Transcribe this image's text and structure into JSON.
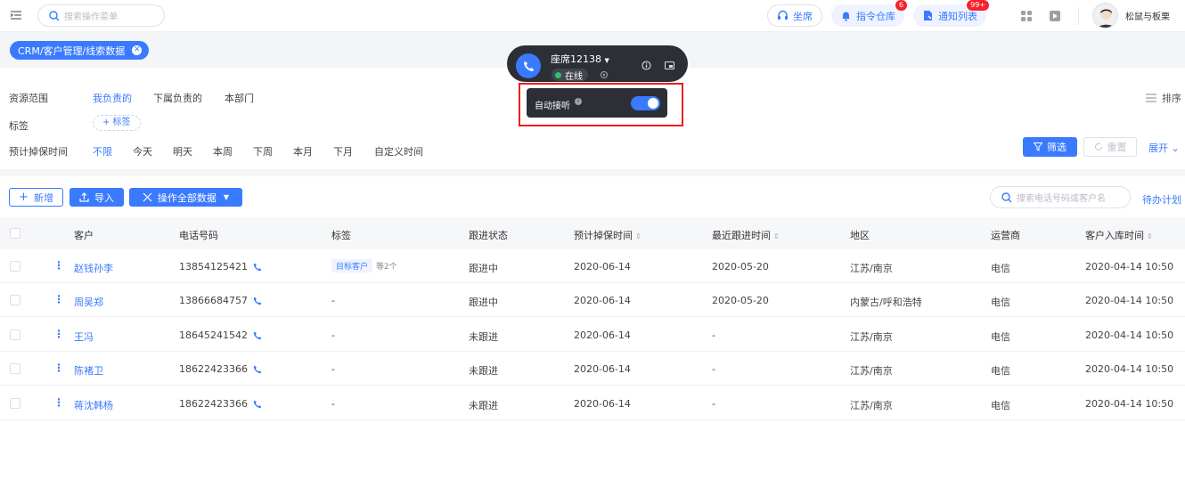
{
  "header": {
    "search_placeholder": "搜索操作菜单",
    "seat_label": "坐席",
    "command_label": "指令仓库",
    "command_badge": "6",
    "notify_label": "通知列表",
    "notify_badge": "99+",
    "user_name": "松鼠与板栗"
  },
  "tabs": {
    "crumb": "CRM/客户管理/线索数据"
  },
  "filters": {
    "scope_label": "资源范围",
    "scope_options": [
      "我负责的",
      "下属负责的",
      "本部门"
    ],
    "tag_label": "标签",
    "tag_add": "+ 标签",
    "time_label": "预计掉保时间",
    "time_options": [
      "不限",
      "今天",
      "明天",
      "本周",
      "下周",
      "本月",
      "下月",
      "自定义时间"
    ],
    "sort_label": "排序",
    "filter_button": "筛选",
    "reset_button": "重置",
    "expand_label": "展开"
  },
  "toolbar": {
    "add_label": "新增",
    "import_label": "导入",
    "bulk_label": "操作全部数据",
    "search_placeholder": "搜索电话号码或客户名",
    "todo_label": "待办计划"
  },
  "table": {
    "columns": [
      "客户",
      "电话号码",
      "标签",
      "跟进状态",
      "预计掉保时间",
      "最近跟进时间",
      "地区",
      "运营商",
      "客户入库时间"
    ],
    "rows": [
      {
        "customer": "赵钱孙李",
        "phone": "13854125421",
        "tag": "目标客户",
        "tag_more": "等2个",
        "status": "跟进中",
        "expire": "2020-06-14",
        "last": "2020-05-20",
        "region": "江苏/南京",
        "carrier": "电信",
        "stored": "2020-04-14  10:50"
      },
      {
        "customer": "周吴郑",
        "phone": "13866684757",
        "tag": "-",
        "tag_more": "",
        "status": "跟进中",
        "expire": "2020-06-14",
        "last": "2020-05-20",
        "region": "内蒙古/呼和浩特",
        "carrier": "电信",
        "stored": "2020-04-14  10:50"
      },
      {
        "customer": "王冯",
        "phone": "18645241542",
        "tag": "-",
        "tag_more": "",
        "status": "未跟进",
        "expire": "2020-06-14",
        "last": "-",
        "region": "江苏/南京",
        "carrier": "电信",
        "stored": "2020-04-14  10:50"
      },
      {
        "customer": "陈褚卫",
        "phone": "18622423366",
        "tag": "-",
        "tag_more": "",
        "status": "未跟进",
        "expire": "2020-06-14",
        "last": "-",
        "region": "江苏/南京",
        "carrier": "电信",
        "stored": "2020-04-14  10:50"
      },
      {
        "customer": "蒋沈韩杨",
        "phone": "18622423366",
        "tag": "-",
        "tag_more": "",
        "status": "未跟进",
        "expire": "2020-06-14",
        "last": "-",
        "region": "江苏/南京",
        "carrier": "电信",
        "stored": "2020-04-14  10:50"
      }
    ]
  },
  "cti": {
    "seat": "座席12138",
    "status": "在线",
    "auto_answer_label": "自动接听",
    "auto_answer_on": true
  },
  "colors": {
    "accent": "#3a7afe",
    "panel": "#2d2f36",
    "online": "#29c46a",
    "highlight": "#f01d1d"
  }
}
